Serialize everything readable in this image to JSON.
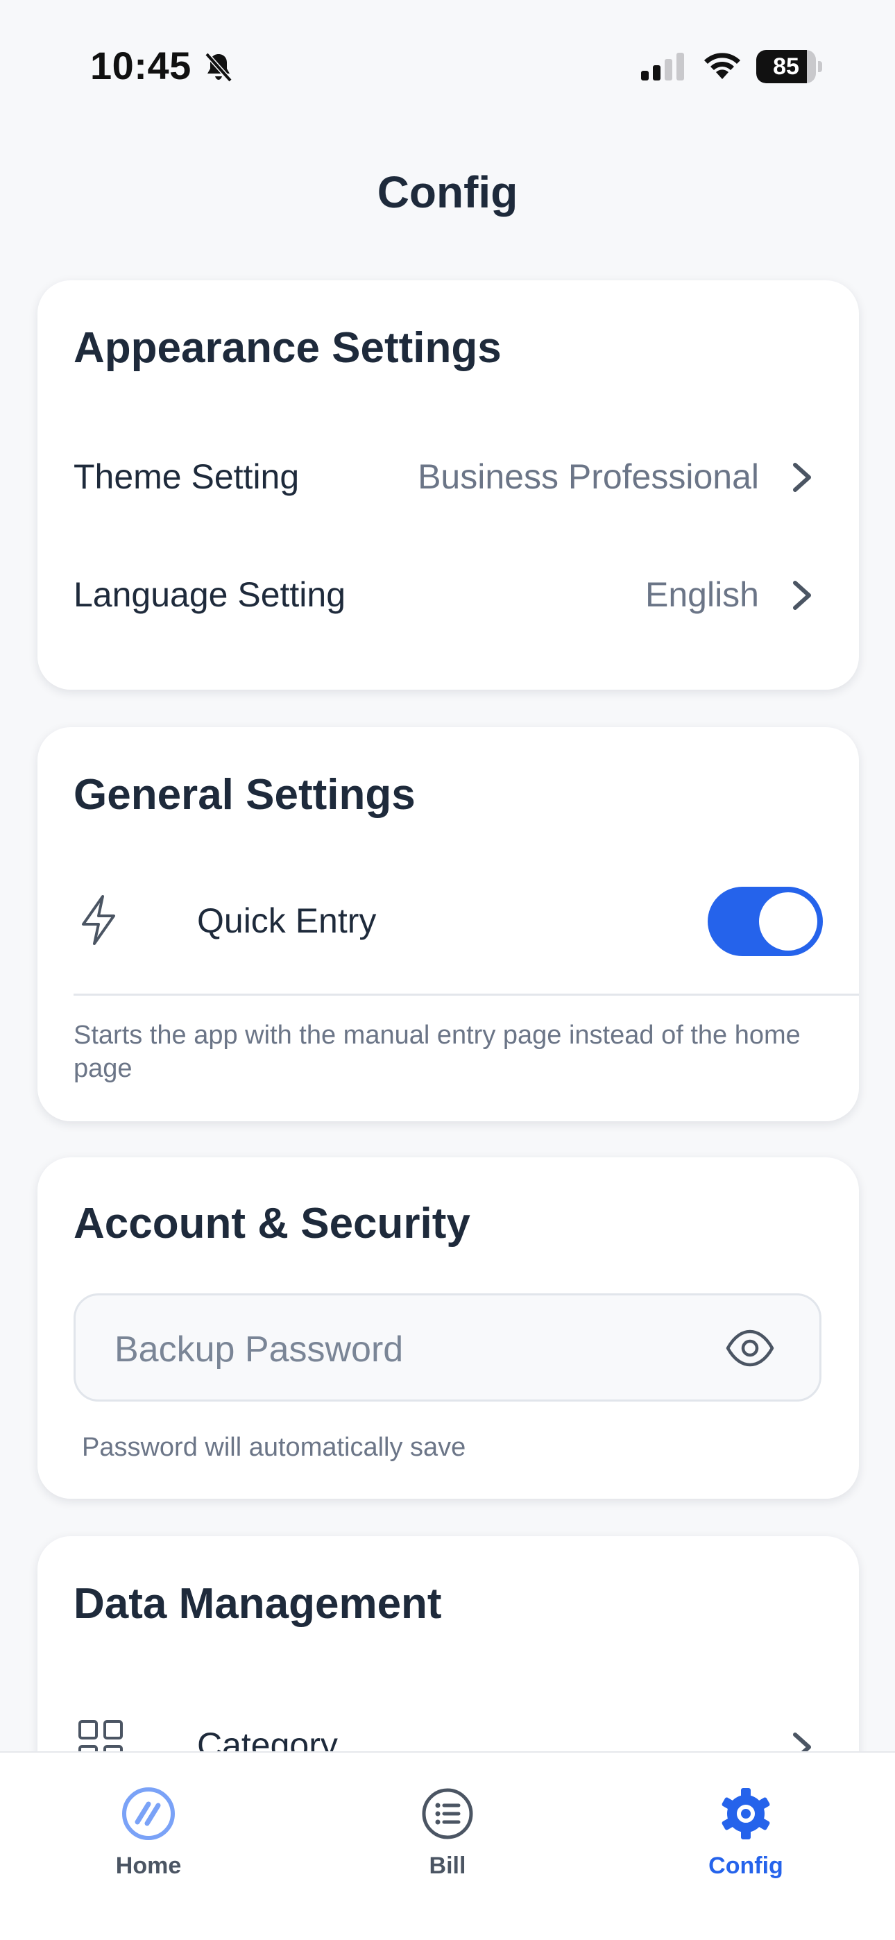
{
  "status_bar": {
    "time": "10:45",
    "battery": "85",
    "battery_level": 0.85
  },
  "header": {
    "title": "Config"
  },
  "appearance": {
    "title": "Appearance Settings",
    "theme_label": "Theme Setting",
    "theme_value": "Business Professional",
    "language_label": "Language Setting",
    "language_value": "English"
  },
  "general": {
    "title": "General Settings",
    "quick_entry_label": "Quick Entry",
    "quick_entry_enabled": true,
    "quick_entry_hint": "Starts the app with the manual entry page instead of the home page"
  },
  "account": {
    "title": "Account & Security",
    "password_placeholder": "Backup Password",
    "password_hint": "Password will automatically save"
  },
  "data_management": {
    "title": "Data Management",
    "category_label": "Category"
  },
  "bottom_nav": {
    "items": [
      {
        "label": "Home",
        "icon": "home-slash-icon",
        "active": false
      },
      {
        "label": "Bill",
        "icon": "list-icon",
        "active": false
      },
      {
        "label": "Config",
        "icon": "gear-icon",
        "active": true
      }
    ]
  },
  "colors": {
    "accent": "#2563eb",
    "background": "#f7f8fa",
    "card": "#ffffff",
    "text_primary": "#1e2a3b",
    "text_secondary": "#6b7587"
  }
}
